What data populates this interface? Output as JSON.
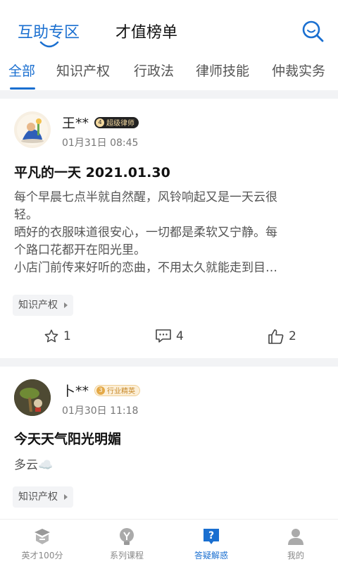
{
  "header": {
    "tabs": [
      {
        "label": "互助专区",
        "active": true
      },
      {
        "label": "才值榜单",
        "active": false
      }
    ],
    "search_icon": "search-icon"
  },
  "categories": [
    "全部",
    "知识产权",
    "行政法",
    "律师技能",
    "仲裁实务"
  ],
  "posts": [
    {
      "author": "王**",
      "badge_level": "4",
      "badge_text": "超级律师",
      "time": "01月31日 08:45",
      "title": "平凡的一天  2021.01.30",
      "lines": [
        "每个早晨七点半就自然醒，风铃响起又是一天云很",
        "轻。",
        "晒好的衣服味道很安心，一切都是柔软又宁静。每",
        "个路口花都开在阳光里。",
        "小店门前传来好听的恋曲，不用太久就能走到目…"
      ],
      "tag": "知识产权",
      "likes": "1",
      "comments": "4",
      "thumbs": "2"
    },
    {
      "author": "卜**",
      "badge_level": "3",
      "badge_text": "行业精英",
      "time": "01月30日 11:18",
      "title": "今天天气阳光明媚",
      "lines": [
        "多云☁️"
      ],
      "tag": "知识产权"
    }
  ],
  "bottom_nav": [
    {
      "label": "英才100分",
      "icon": "book-icon",
      "active": false
    },
    {
      "label": "系列课程",
      "icon": "lightbulb-icon",
      "active": false
    },
    {
      "label": "答疑解惑",
      "icon": "question-icon",
      "active": true
    },
    {
      "label": "我的",
      "icon": "user-icon",
      "active": false
    }
  ],
  "colors": {
    "accent": "#1a6fd0",
    "muted": "#888888",
    "divider": "#f2f3f5"
  }
}
